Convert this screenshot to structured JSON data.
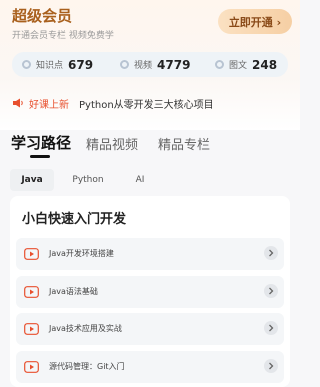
{
  "vip": {
    "title": "超级会员",
    "subtitle": "开通会员专栏 视频免费学",
    "open_button": "立即开通 ›"
  },
  "stats": [
    {
      "label": "知识点",
      "value": "679",
      "icon": "knowledge-icon"
    },
    {
      "label": "视频",
      "value": "4779",
      "icon": "video-icon"
    },
    {
      "label": "图文",
      "value": "248",
      "icon": "article-icon"
    }
  ],
  "news": {
    "icon": "speaker-icon",
    "tag": "好课上新",
    "text": "Python从零开发三大核心项目"
  },
  "tabs": [
    {
      "label": "学习路径",
      "active": true
    },
    {
      "label": "精品视频",
      "active": false
    },
    {
      "label": "精品专栏",
      "active": false
    }
  ],
  "subtabs": [
    {
      "label": "Java",
      "active": true
    },
    {
      "label": "Python",
      "active": false
    },
    {
      "label": "AI",
      "active": false
    }
  ],
  "panel": {
    "title": "小白快速入门开发",
    "lessons": [
      {
        "name": "Java开发环境搭建"
      },
      {
        "name": "Java语法基础"
      },
      {
        "name": "Java技术应用及实战"
      },
      {
        "name": "源代码管理：Git入门"
      }
    ]
  },
  "colors": {
    "vip_gold": "#a9601d",
    "accent_red": "#e8502e",
    "stat_bg": "#eef3f7"
  }
}
